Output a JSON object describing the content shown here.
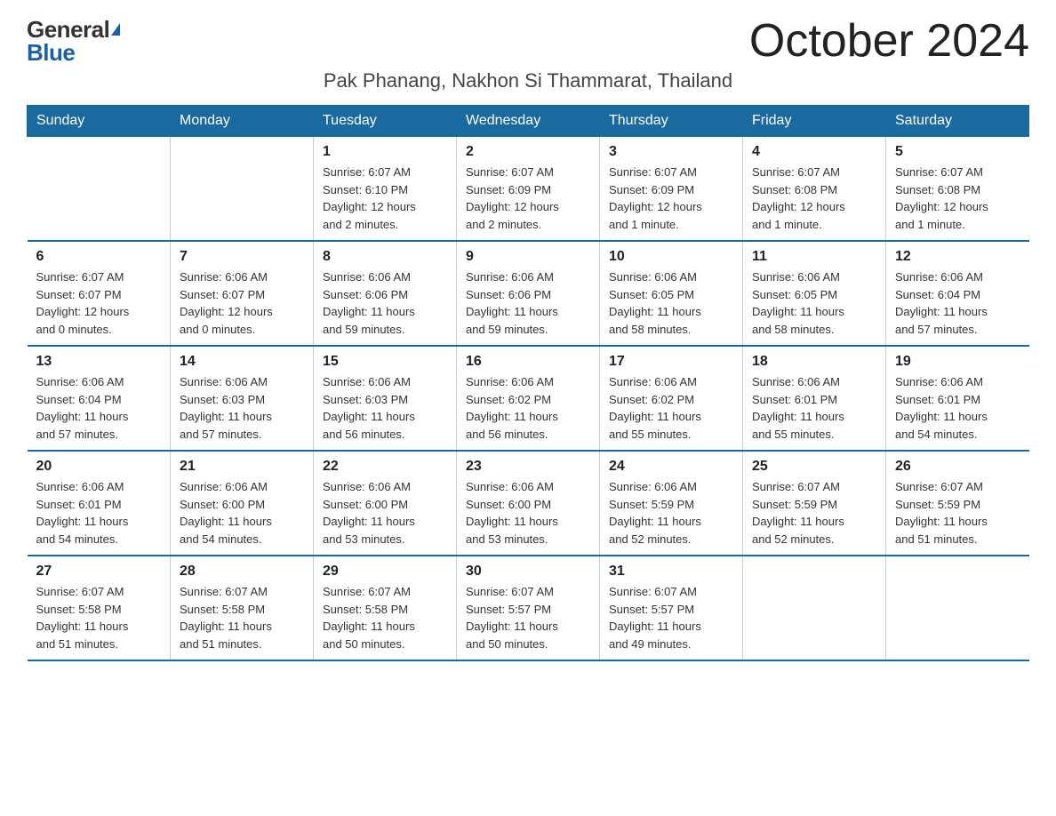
{
  "logo": {
    "general": "General",
    "blue": "Blue"
  },
  "header": {
    "month_year": "October 2024",
    "subtitle": "Pak Phanang, Nakhon Si Thammarat, Thailand"
  },
  "days_of_week": [
    "Sunday",
    "Monday",
    "Tuesday",
    "Wednesday",
    "Thursday",
    "Friday",
    "Saturday"
  ],
  "weeks": [
    [
      {
        "day": "",
        "info": ""
      },
      {
        "day": "",
        "info": ""
      },
      {
        "day": "1",
        "info": "Sunrise: 6:07 AM\nSunset: 6:10 PM\nDaylight: 12 hours\nand 2 minutes."
      },
      {
        "day": "2",
        "info": "Sunrise: 6:07 AM\nSunset: 6:09 PM\nDaylight: 12 hours\nand 2 minutes."
      },
      {
        "day": "3",
        "info": "Sunrise: 6:07 AM\nSunset: 6:09 PM\nDaylight: 12 hours\nand 1 minute."
      },
      {
        "day": "4",
        "info": "Sunrise: 6:07 AM\nSunset: 6:08 PM\nDaylight: 12 hours\nand 1 minute."
      },
      {
        "day": "5",
        "info": "Sunrise: 6:07 AM\nSunset: 6:08 PM\nDaylight: 12 hours\nand 1 minute."
      }
    ],
    [
      {
        "day": "6",
        "info": "Sunrise: 6:07 AM\nSunset: 6:07 PM\nDaylight: 12 hours\nand 0 minutes."
      },
      {
        "day": "7",
        "info": "Sunrise: 6:06 AM\nSunset: 6:07 PM\nDaylight: 12 hours\nand 0 minutes."
      },
      {
        "day": "8",
        "info": "Sunrise: 6:06 AM\nSunset: 6:06 PM\nDaylight: 11 hours\nand 59 minutes."
      },
      {
        "day": "9",
        "info": "Sunrise: 6:06 AM\nSunset: 6:06 PM\nDaylight: 11 hours\nand 59 minutes."
      },
      {
        "day": "10",
        "info": "Sunrise: 6:06 AM\nSunset: 6:05 PM\nDaylight: 11 hours\nand 58 minutes."
      },
      {
        "day": "11",
        "info": "Sunrise: 6:06 AM\nSunset: 6:05 PM\nDaylight: 11 hours\nand 58 minutes."
      },
      {
        "day": "12",
        "info": "Sunrise: 6:06 AM\nSunset: 6:04 PM\nDaylight: 11 hours\nand 57 minutes."
      }
    ],
    [
      {
        "day": "13",
        "info": "Sunrise: 6:06 AM\nSunset: 6:04 PM\nDaylight: 11 hours\nand 57 minutes."
      },
      {
        "day": "14",
        "info": "Sunrise: 6:06 AM\nSunset: 6:03 PM\nDaylight: 11 hours\nand 57 minutes."
      },
      {
        "day": "15",
        "info": "Sunrise: 6:06 AM\nSunset: 6:03 PM\nDaylight: 11 hours\nand 56 minutes."
      },
      {
        "day": "16",
        "info": "Sunrise: 6:06 AM\nSunset: 6:02 PM\nDaylight: 11 hours\nand 56 minutes."
      },
      {
        "day": "17",
        "info": "Sunrise: 6:06 AM\nSunset: 6:02 PM\nDaylight: 11 hours\nand 55 minutes."
      },
      {
        "day": "18",
        "info": "Sunrise: 6:06 AM\nSunset: 6:01 PM\nDaylight: 11 hours\nand 55 minutes."
      },
      {
        "day": "19",
        "info": "Sunrise: 6:06 AM\nSunset: 6:01 PM\nDaylight: 11 hours\nand 54 minutes."
      }
    ],
    [
      {
        "day": "20",
        "info": "Sunrise: 6:06 AM\nSunset: 6:01 PM\nDaylight: 11 hours\nand 54 minutes."
      },
      {
        "day": "21",
        "info": "Sunrise: 6:06 AM\nSunset: 6:00 PM\nDaylight: 11 hours\nand 54 minutes."
      },
      {
        "day": "22",
        "info": "Sunrise: 6:06 AM\nSunset: 6:00 PM\nDaylight: 11 hours\nand 53 minutes."
      },
      {
        "day": "23",
        "info": "Sunrise: 6:06 AM\nSunset: 6:00 PM\nDaylight: 11 hours\nand 53 minutes."
      },
      {
        "day": "24",
        "info": "Sunrise: 6:06 AM\nSunset: 5:59 PM\nDaylight: 11 hours\nand 52 minutes."
      },
      {
        "day": "25",
        "info": "Sunrise: 6:07 AM\nSunset: 5:59 PM\nDaylight: 11 hours\nand 52 minutes."
      },
      {
        "day": "26",
        "info": "Sunrise: 6:07 AM\nSunset: 5:59 PM\nDaylight: 11 hours\nand 51 minutes."
      }
    ],
    [
      {
        "day": "27",
        "info": "Sunrise: 6:07 AM\nSunset: 5:58 PM\nDaylight: 11 hours\nand 51 minutes."
      },
      {
        "day": "28",
        "info": "Sunrise: 6:07 AM\nSunset: 5:58 PM\nDaylight: 11 hours\nand 51 minutes."
      },
      {
        "day": "29",
        "info": "Sunrise: 6:07 AM\nSunset: 5:58 PM\nDaylight: 11 hours\nand 50 minutes."
      },
      {
        "day": "30",
        "info": "Sunrise: 6:07 AM\nSunset: 5:57 PM\nDaylight: 11 hours\nand 50 minutes."
      },
      {
        "day": "31",
        "info": "Sunrise: 6:07 AM\nSunset: 5:57 PM\nDaylight: 11 hours\nand 49 minutes."
      },
      {
        "day": "",
        "info": ""
      },
      {
        "day": "",
        "info": ""
      }
    ]
  ]
}
